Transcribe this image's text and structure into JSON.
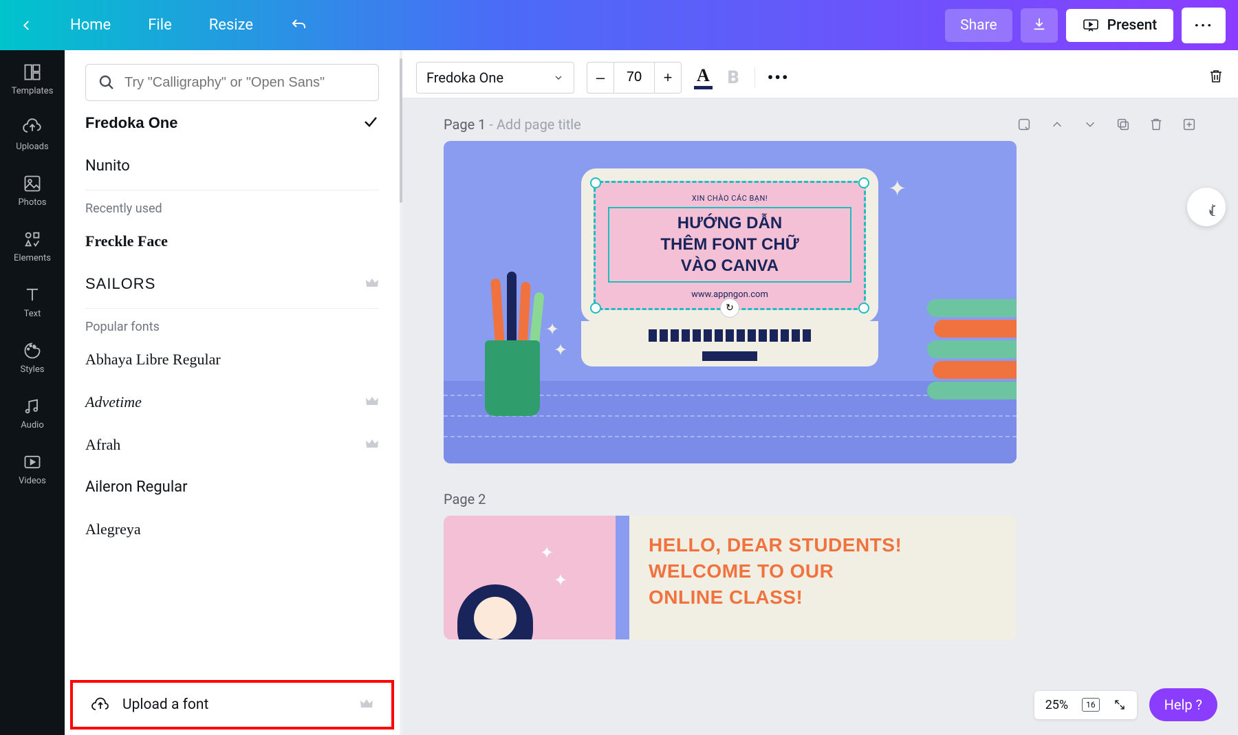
{
  "header": {
    "home": "Home",
    "file": "File",
    "resize": "Resize",
    "share": "Share",
    "present": "Present"
  },
  "rail": [
    {
      "label": "Templates"
    },
    {
      "label": "Uploads"
    },
    {
      "label": "Photos"
    },
    {
      "label": "Elements"
    },
    {
      "label": "Text"
    },
    {
      "label": "Styles"
    },
    {
      "label": "Audio"
    },
    {
      "label": "Videos"
    }
  ],
  "fontPanel": {
    "searchPlaceholder": "Try \"Calligraphy\" or \"Open Sans\"",
    "current": [
      {
        "name": "Fredoka One",
        "selected": true
      },
      {
        "name": "Nunito"
      }
    ],
    "recentTitle": "Recently used",
    "recent": [
      {
        "name": "Freckle Face",
        "cls": "f-freckle"
      },
      {
        "name": "SAILORS",
        "cls": "f-sailors",
        "pro": true
      }
    ],
    "popularTitle": "Popular fonts",
    "popular": [
      {
        "name": "Abhaya Libre Regular",
        "cls": "f-abhaya"
      },
      {
        "name": "Advetime",
        "cls": "f-advetime",
        "pro": true
      },
      {
        "name": "Afrah",
        "cls": "f-afrah",
        "pro": true
      },
      {
        "name": "Aileron Regular",
        "cls": "f-aileron"
      },
      {
        "name": "Alegreya",
        "cls": "f-alegreya"
      }
    ],
    "upload": "Upload a font"
  },
  "toolbar": {
    "fontName": "Fredoka One",
    "fontSize": "70",
    "minus": "–",
    "plus": "+",
    "colorA": "A",
    "boldB": "B",
    "more": "•••"
  },
  "page1": {
    "label": "Page 1",
    "placeholder": " - Add page title",
    "subtitle": "XIN CHÀO CÁC BẠN!",
    "mainL1": "HƯỚNG DẪN",
    "mainL2": "THÊM FONT CHỮ",
    "mainL3": "VÀO CANVA",
    "url": "www.appngon.com",
    "sync": "↻"
  },
  "page2": {
    "label": "Page 2",
    "textL1": "HELLO, DEAR STUDENTS!",
    "textL2": "WELCOME TO OUR",
    "textL3": "ONLINE CLASS!"
  },
  "bottom": {
    "zoom": "25%",
    "pages": "16",
    "help": "Help ?"
  }
}
